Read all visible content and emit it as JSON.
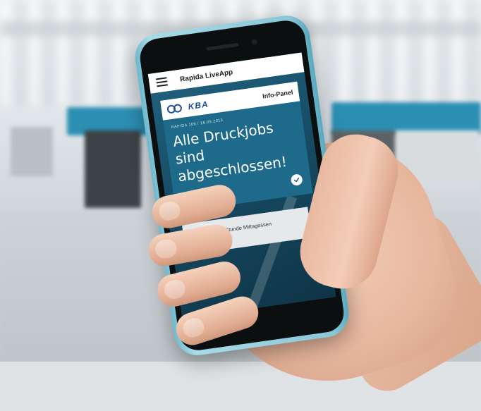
{
  "app": {
    "title": "Rapida LiveApp"
  },
  "panel": {
    "logo_text": "KBA",
    "header_label": "Info-Panel",
    "kicker": "RAPIDA 106 / 16.09.2015",
    "headline": "Alle Druckjobs sind abgeschlossen!",
    "status_icon": "check-icon"
  },
  "note": {
    "text": "In einer halben Stunde Mittagessen mit Thomas"
  },
  "colors": {
    "screen_bg": "#22566f",
    "panel_blue": "#1e6a8a",
    "logo_blue": "#1f4f9a",
    "phone_frame": "#88c7d8"
  }
}
